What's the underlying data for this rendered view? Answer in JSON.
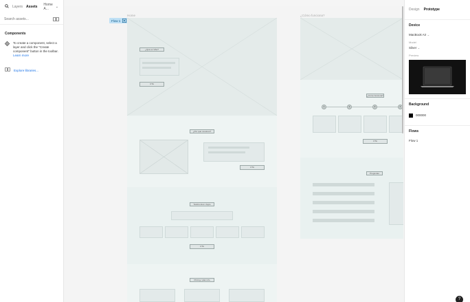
{
  "left_panel": {
    "tabs": [
      "Layers",
      "Assets"
    ],
    "active_tab": "Assets",
    "page_picker": "Home A...",
    "search_placeholder": "Search assets...",
    "components_title": "Components",
    "components_info": "To create a component, select a layer and click the \"Create component\" button in the toolbar.",
    "learn_more": "Learn more",
    "explore_libraries": "Explore libraries..."
  },
  "canvas": {
    "frames": [
      {
        "label": "Home"
      },
      {
        "label": "¿Cómo funciona?"
      }
    ],
    "flow_badge": "Flow 1",
    "wire_labels": {
      "hero_tag": "¿Qué es Vibe?",
      "hero_cta": "CTA",
      "section2_title": "¿Por qué nosotros?",
      "section2_cta": "CTA",
      "section3_title": "Testimonios / Apps",
      "section3_cta": "CTA",
      "section4_title": "Pricing / plan info",
      "how_title": "¿Cómo funciona?",
      "how_cta": "CTA",
      "faq_title": "Preguntas"
    },
    "steps": [
      "1",
      "2",
      "3",
      "4"
    ]
  },
  "right_panel": {
    "tabs": [
      "Design",
      "Prototype"
    ],
    "active_tab": "Prototype",
    "device_title": "Device",
    "device_value": "MacBook Air",
    "model_label": "Model",
    "model_value": "Silver",
    "preview_label": "Preview",
    "background_title": "Background",
    "background_value": "000000",
    "flows_title": "Flows",
    "flows": [
      "Flow 1"
    ]
  },
  "help_label": "?",
  "colors": {
    "accent": "#1a73e8",
    "canvas": "#f4f4f4",
    "wire": "#eef3f2",
    "flow_badge": "#bfe0f5"
  }
}
